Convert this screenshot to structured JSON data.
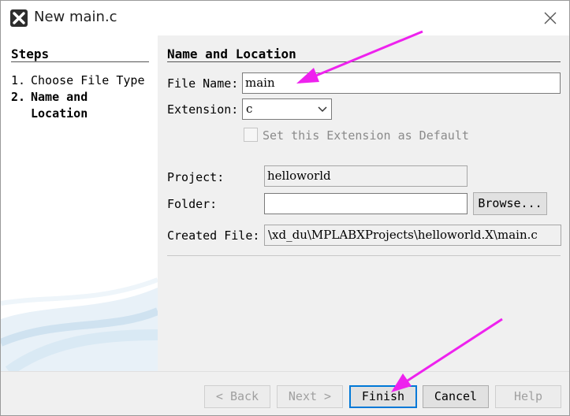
{
  "window": {
    "title": "New main.c"
  },
  "steps": {
    "heading": "Steps",
    "items": [
      {
        "num": "1.",
        "label": "Choose File Type"
      },
      {
        "num": "2.",
        "label": "Name and",
        "label_cont": "Location"
      }
    ]
  },
  "panel": {
    "heading": "Name and Location",
    "file_name_label": "File Name:",
    "file_name_value": "main",
    "extension_label": "Extension:",
    "extension_value": "c",
    "default_ext_label": "Set this Extension as Default",
    "project_label": "Project:",
    "project_value": "helloworld",
    "folder_label": "Folder:",
    "folder_value": "",
    "browse_label": "Browse...",
    "created_label": "Created File:",
    "created_value": "\\xd_du\\MPLABXProjects\\helloworld.X\\main.c"
  },
  "buttons": {
    "back": "< Back",
    "next": "Next >",
    "finish": "Finish",
    "cancel": "Cancel",
    "help": "Help"
  },
  "colors": {
    "annotation_arrow": "#ee22ee",
    "primary_border": "#0078d7"
  }
}
